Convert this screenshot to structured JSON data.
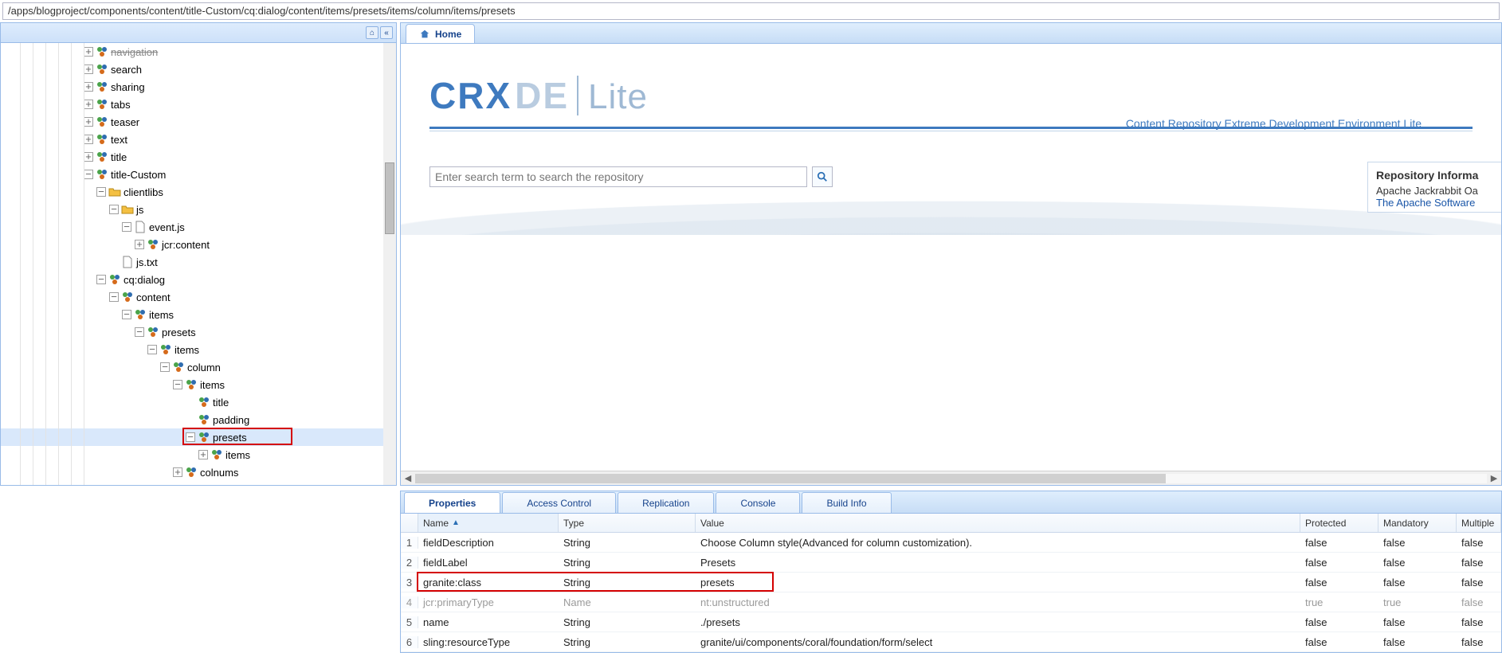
{
  "path": "/apps/blogproject/components/content/title-Custom/cq:dialog/content/items/presets/items/column/items/presets",
  "home_tab": "Home",
  "logo": {
    "crxde": "CRXDE",
    "lite": "Lite"
  },
  "tagline": "Content Repository Extreme Development Environment Lite",
  "search": {
    "placeholder": "Enter search term to search the repository"
  },
  "repo_card": {
    "title": "Repository Informa",
    "line1": "Apache Jackrabbit Oa",
    "link": "The Apache Software"
  },
  "tree": [
    {
      "depth": 6,
      "toggle": "plus",
      "icon": "comp",
      "label": "navigation",
      "cut": true
    },
    {
      "depth": 6,
      "toggle": "plus",
      "icon": "comp",
      "label": "search"
    },
    {
      "depth": 6,
      "toggle": "plus",
      "icon": "comp",
      "label": "sharing"
    },
    {
      "depth": 6,
      "toggle": "plus",
      "icon": "comp",
      "label": "tabs"
    },
    {
      "depth": 6,
      "toggle": "plus",
      "icon": "comp",
      "label": "teaser"
    },
    {
      "depth": 6,
      "toggle": "plus",
      "icon": "comp",
      "label": "text"
    },
    {
      "depth": 6,
      "toggle": "plus",
      "icon": "comp",
      "label": "title"
    },
    {
      "depth": 6,
      "toggle": "minus",
      "icon": "comp",
      "label": "title-Custom"
    },
    {
      "depth": 7,
      "toggle": "minus",
      "icon": "folder",
      "label": "clientlibs"
    },
    {
      "depth": 8,
      "toggle": "minus",
      "icon": "folder",
      "label": "js"
    },
    {
      "depth": 9,
      "toggle": "minus",
      "icon": "file",
      "label": "event.js"
    },
    {
      "depth": 10,
      "toggle": "plus",
      "icon": "comp",
      "label": "jcr:content"
    },
    {
      "depth": 8,
      "toggle": "none",
      "icon": "file",
      "label": "js.txt"
    },
    {
      "depth": 7,
      "toggle": "minus",
      "icon": "comp",
      "label": "cq:dialog"
    },
    {
      "depth": 8,
      "toggle": "minus",
      "icon": "comp",
      "label": "content"
    },
    {
      "depth": 9,
      "toggle": "minus",
      "icon": "comp",
      "label": "items"
    },
    {
      "depth": 10,
      "toggle": "minus",
      "icon": "comp",
      "label": "presets"
    },
    {
      "depth": 11,
      "toggle": "minus",
      "icon": "comp",
      "label": "items"
    },
    {
      "depth": 12,
      "toggle": "minus",
      "icon": "comp",
      "label": "column"
    },
    {
      "depth": 13,
      "toggle": "minus",
      "icon": "comp",
      "label": "items"
    },
    {
      "depth": 14,
      "toggle": "none",
      "icon": "comp",
      "label": "title"
    },
    {
      "depth": 14,
      "toggle": "none",
      "icon": "comp",
      "label": "padding"
    },
    {
      "depth": 14,
      "toggle": "minus",
      "icon": "comp",
      "label": "presets",
      "selected": true,
      "redbox": true
    },
    {
      "depth": 15,
      "toggle": "plus",
      "icon": "comp",
      "label": "items"
    },
    {
      "depth": 13,
      "toggle": "plus",
      "icon": "comp",
      "label": "colnums"
    }
  ],
  "bottom_tabs": [
    "Properties",
    "Access Control",
    "Replication",
    "Console",
    "Build Info"
  ],
  "grid": {
    "headers": {
      "name": "Name",
      "type": "Type",
      "value": "Value",
      "protected": "Protected",
      "mandatory": "Mandatory",
      "multiple": "Multiple"
    },
    "rows": [
      {
        "n": "1",
        "name": "fieldDescription",
        "type": "String",
        "value": "Choose Column style(Advanced for column customization).",
        "protected": "false",
        "mandatory": "false",
        "multiple": "false"
      },
      {
        "n": "2",
        "name": "fieldLabel",
        "type": "String",
        "value": "Presets",
        "protected": "false",
        "mandatory": "false",
        "multiple": "false"
      },
      {
        "n": "3",
        "name": "granite:class",
        "type": "String",
        "value": "presets",
        "protected": "false",
        "mandatory": "false",
        "multiple": "false",
        "redbox": true
      },
      {
        "n": "4",
        "name": "jcr:primaryType",
        "type": "Name",
        "value": "nt:unstructured",
        "protected": "true",
        "mandatory": "true",
        "multiple": "false",
        "dim": true
      },
      {
        "n": "5",
        "name": "name",
        "type": "String",
        "value": "./presets",
        "protected": "false",
        "mandatory": "false",
        "multiple": "false"
      },
      {
        "n": "6",
        "name": "sling:resourceType",
        "type": "String",
        "value": "granite/ui/components/coral/foundation/form/select",
        "protected": "false",
        "mandatory": "false",
        "multiple": "false"
      }
    ]
  }
}
